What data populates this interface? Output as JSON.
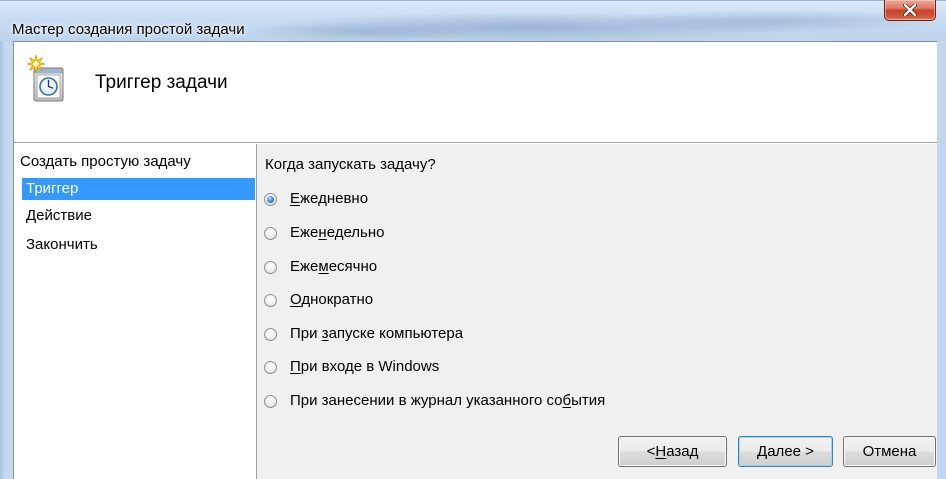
{
  "window": {
    "title": "Мастер создания простой задачи",
    "close_icon": "close-icon"
  },
  "header": {
    "title": "Триггер задачи",
    "icon": "task-scheduler-icon"
  },
  "sidebar": {
    "steps": [
      {
        "label": "Создать простую задачу",
        "selected": false
      },
      {
        "label": "Триггер",
        "selected": true
      },
      {
        "label": "Действие",
        "selected": false
      },
      {
        "label": "Закончить",
        "selected": false
      }
    ]
  },
  "content": {
    "question": "Когда запускать задачу?",
    "options": [
      {
        "label": "Ежедневно",
        "checked": true,
        "access_key_index": 0
      },
      {
        "label": "Еженедельно",
        "checked": false,
        "access_key_index": 3
      },
      {
        "label": "Ежемесячно",
        "checked": false,
        "access_key_index": 3
      },
      {
        "label": "Однократно",
        "checked": false,
        "access_key_index": 0
      },
      {
        "label": "При запуске компьютера",
        "checked": false,
        "access_key_index": 4
      },
      {
        "label": "При входе в Windows",
        "checked": false,
        "access_key_index": 0
      },
      {
        "label": "При занесении в журнал указанного события",
        "checked": false,
        "access_key_index": 36
      }
    ]
  },
  "buttons": {
    "back": {
      "label": "< Назад",
      "access_key_index": 2
    },
    "next": {
      "label": "Далее >",
      "access_key_index": 0,
      "is_default": true
    },
    "cancel": {
      "label": "Отмена"
    }
  },
  "colors": {
    "selection_bg": "#3399ff",
    "selection_text": "#ffffff",
    "content_bg": "#f0f0f0",
    "sidebar_bg": "#ffffff",
    "header_bg": "#ffffff",
    "default_button_border": "#3c7fb1",
    "close_button": "#c7432a"
  }
}
